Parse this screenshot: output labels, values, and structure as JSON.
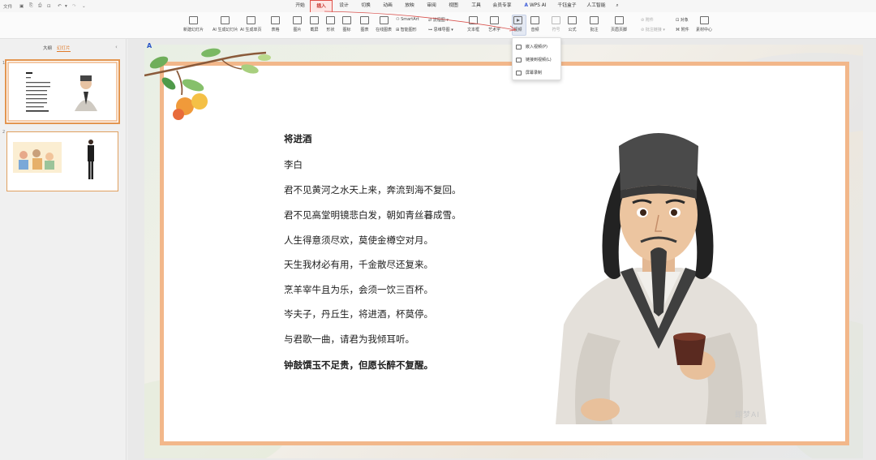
{
  "menubar": {
    "file_label": "文件",
    "tabs": [
      {
        "label": "开始"
      },
      {
        "label": "插入"
      },
      {
        "label": "设计"
      },
      {
        "label": "切换"
      },
      {
        "label": "动画"
      },
      {
        "label": "放映"
      },
      {
        "label": "审阅"
      },
      {
        "label": "视图"
      },
      {
        "label": "工具"
      },
      {
        "label": "会员专享"
      },
      {
        "label": "WPS AI"
      },
      {
        "label": "千钰盒子"
      },
      {
        "label": "人工智能"
      }
    ],
    "active_tab": "插入"
  },
  "ribbon": {
    "new_slide": "新建幻灯片",
    "ai_slide": "AI 生成幻灯片",
    "ai_single": "AI 生成单页",
    "table": "表格",
    "image": "图片",
    "screenshot": "截屏",
    "shape": "形状",
    "icon": "图标",
    "chart": "图表",
    "online_chart": "在线图表",
    "smart_graphic": "智能图形",
    "smartart": "SmartArt",
    "flowchart": "流程图",
    "mindmap": "思维导图",
    "textbox": "文本框",
    "art_text": "艺术字",
    "video": "视频",
    "audio": "音频",
    "symbol": "符号",
    "formula": "公式",
    "comment": "批注",
    "header_footer": "页眉页脚",
    "attachment_top": "附件",
    "attachment_bottom": "批注链接",
    "object": "对象",
    "attach": "附件",
    "resource": "素材中心"
  },
  "video_menu": {
    "items": [
      {
        "label": "嵌入视频(P)"
      },
      {
        "label": "链接到视频(L)"
      },
      {
        "label": "屏幕录制"
      }
    ]
  },
  "left_panel": {
    "tab_outline": "大纲",
    "tab_slides": "幻灯片",
    "slides": [
      {
        "number": "1"
      },
      {
        "number": "2"
      }
    ]
  },
  "slide": {
    "poem": {
      "title": "将进酒",
      "author": "李白",
      "lines": [
        "君不见黄河之水天上来，奔流到海不复回。",
        "君不见高堂明镜悲白发，朝如青丝暮成雪。",
        "人生得意须尽欢，莫使金樽空对月。",
        "天生我材必有用，千金散尽还复来。",
        "烹羊宰牛且为乐，会须一饮三百杯。",
        "岑夫子，丹丘生，将进酒，杯莫停。",
        "与君歌一曲，请君为我倾耳听。"
      ],
      "last_line": "钟鼓馔玉不足贵，但愿长醉不复醒。"
    },
    "watermark": "即梦AI"
  },
  "colors": {
    "active_tab": "#c7342b",
    "frame_border": "#f2b78a",
    "thumb_selected": "#e39550"
  }
}
